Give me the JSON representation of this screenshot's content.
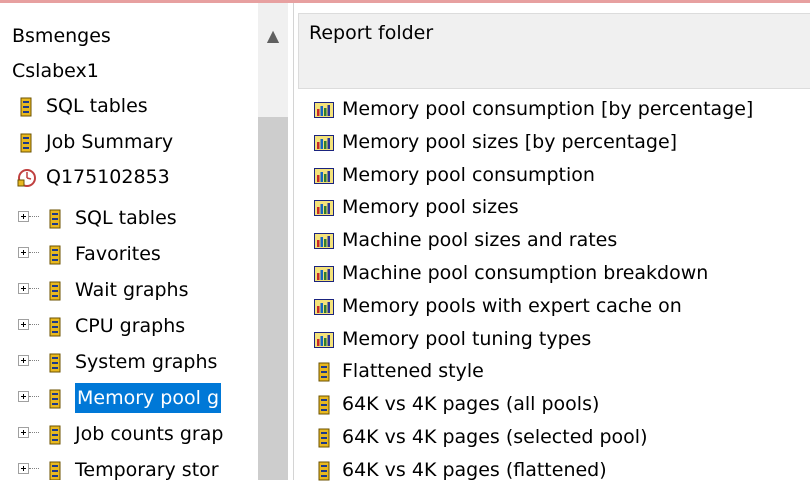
{
  "colors": {
    "top_accent": "#e7a0a0",
    "selection": "#0078d7",
    "header_bg": "#f0f0f0"
  },
  "tree": {
    "items": [
      {
        "label": "Bsmenges",
        "icon": "none"
      },
      {
        "label": "Cslabex1",
        "icon": "none"
      },
      {
        "label": "SQL tables",
        "icon": "folder-doc-icon"
      },
      {
        "label": "Job Summary",
        "icon": "folder-doc-icon"
      },
      {
        "label": "Q175102853",
        "icon": "clock-collection-icon"
      },
      {
        "label": "SQL tables",
        "icon": "folder-doc-icon"
      },
      {
        "label": "Favorites",
        "icon": "folder-doc-icon"
      },
      {
        "label": "Wait graphs",
        "icon": "folder-doc-icon"
      },
      {
        "label": "CPU graphs",
        "icon": "folder-doc-icon"
      },
      {
        "label": "System graphs",
        "icon": "folder-doc-icon"
      },
      {
        "label": "Memory pool g",
        "icon": "folder-doc-icon",
        "selected": true
      },
      {
        "label": "Job counts grap",
        "icon": "folder-doc-icon"
      },
      {
        "label": "Temporary stor",
        "icon": "folder-doc-icon"
      }
    ],
    "scroll_up_glyph": "▲"
  },
  "report_list": {
    "header": "Report folder",
    "items": [
      {
        "label": "Memory pool consumption [by percentage]",
        "icon": "bar-chart-icon"
      },
      {
        "label": "Memory pool sizes [by percentage]",
        "icon": "bar-chart-icon"
      },
      {
        "label": "Memory pool consumption",
        "icon": "bar-chart-icon"
      },
      {
        "label": "Memory pool sizes",
        "icon": "bar-chart-icon"
      },
      {
        "label": "Machine pool sizes and rates",
        "icon": "bar-chart-icon"
      },
      {
        "label": "Machine pool consumption breakdown",
        "icon": "bar-chart-icon"
      },
      {
        "label": "Memory pools with expert cache on",
        "icon": "bar-chart-icon"
      },
      {
        "label": "Memory pool tuning types",
        "icon": "bar-chart-icon"
      },
      {
        "label": "Flattened style",
        "icon": "folder-doc-icon"
      },
      {
        "label": "64K vs 4K pages (all pools)",
        "icon": "folder-doc-icon"
      },
      {
        "label": "64K vs 4K pages (selected pool)",
        "icon": "folder-doc-icon"
      },
      {
        "label": "64K vs 4K pages (flattened)",
        "icon": "folder-doc-icon"
      }
    ]
  }
}
